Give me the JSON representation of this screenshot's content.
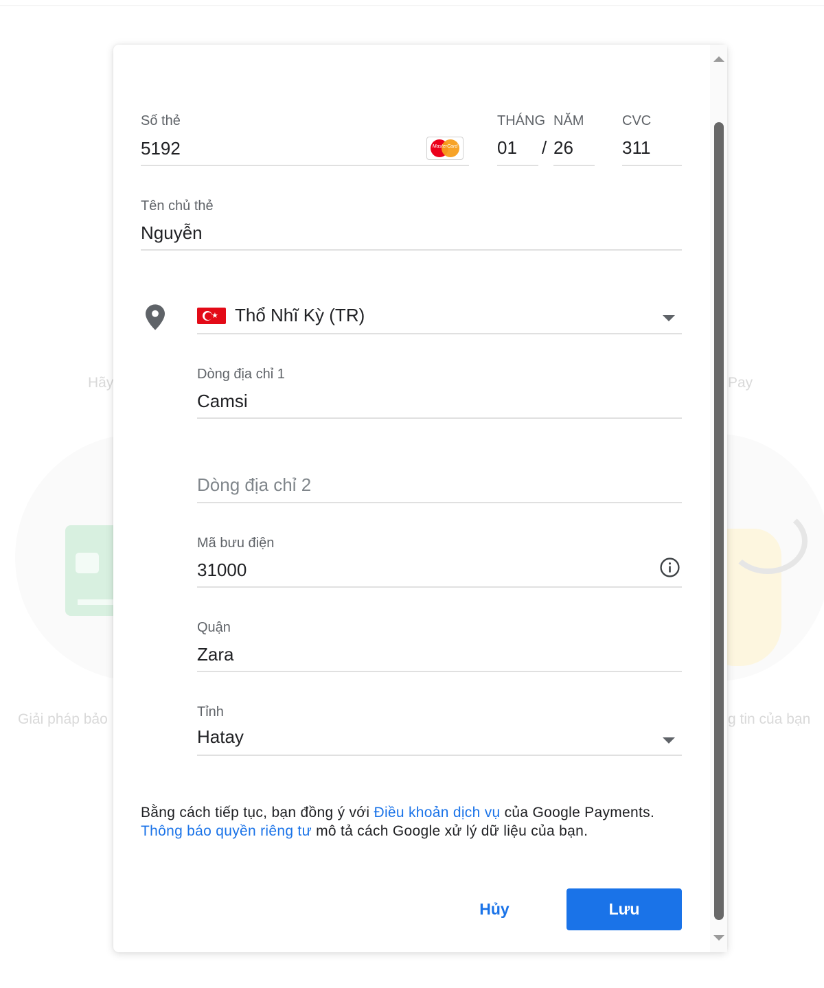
{
  "background": {
    "left_heading_fragment": "Hãy",
    "right_heading_fragment": "Pay",
    "left_caption_fragment": "Giải pháp bảo",
    "right_caption_fragment": "g tin của bạn"
  },
  "card": {
    "number_label": "Số thẻ",
    "number_value": "5192",
    "brand_icon": "mastercard-icon",
    "brand_text": "MasterCard",
    "month_label": "THÁNG",
    "month_value": "01",
    "year_label": "NĂM",
    "date_separator": "/",
    "year_value": "26",
    "cvc_label": "CVC",
    "cvc_value": "311",
    "holder_label": "Tên chủ thẻ",
    "holder_value": "Nguyễn"
  },
  "address": {
    "location_icon": "location-pin-icon",
    "country_value": "Thổ Nhĩ Kỳ (TR)",
    "line1_label": "Dòng địa chỉ 1",
    "line1_value": "Camsi",
    "line2_placeholder": "Dòng địa chỉ 2",
    "postal_label": "Mã bưu điện",
    "postal_value": "31000",
    "district_label": "Quận",
    "district_value": "Zara",
    "province_label": "Tỉnh",
    "province_value": "Hatay"
  },
  "legal": {
    "part1": "Bằng cách tiếp tục, bạn đồng ý với ",
    "terms_link": "Điều khoản dịch vụ",
    "part2": " của Google Payments. ",
    "privacy_link": "Thông báo quyền riêng tư",
    "part3": " mô tả cách Google xử lý dữ liệu của bạn."
  },
  "actions": {
    "cancel_label": "Hủy",
    "save_label": "Lưu"
  },
  "colors": {
    "accent": "#1a73e8",
    "flag_red": "#e30a17",
    "underline": "#e0e0e0"
  }
}
